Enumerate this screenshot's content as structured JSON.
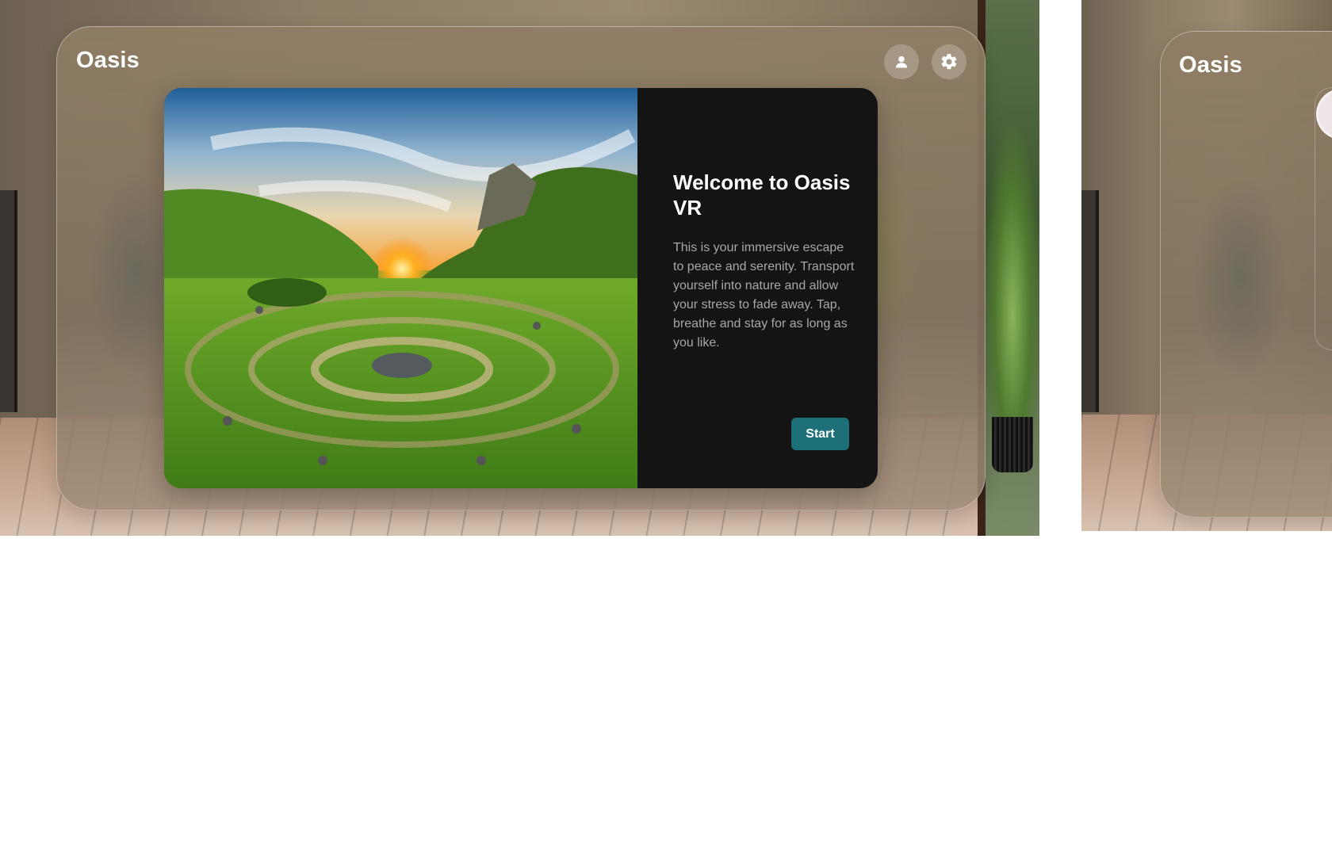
{
  "main_window": {
    "app_title": "Oasis",
    "profile_icon": "person-icon",
    "settings_icon": "gear-icon",
    "welcome_card": {
      "title": "Welcome to Oasis VR",
      "body": "This is your immersive escape to peace and serenity. Transport yourself into nature and allow your stress to fade away. Tap, breathe and stay for as long as you like.",
      "start_label": "Start",
      "image": "nature-landscape-image"
    }
  },
  "secondary_window": {
    "app_title": "Oasis"
  },
  "colors": {
    "accent": "#1d6f78",
    "card_background": "#141414",
    "title_text": "#ffffff",
    "body_text": "#a8a8a8"
  }
}
